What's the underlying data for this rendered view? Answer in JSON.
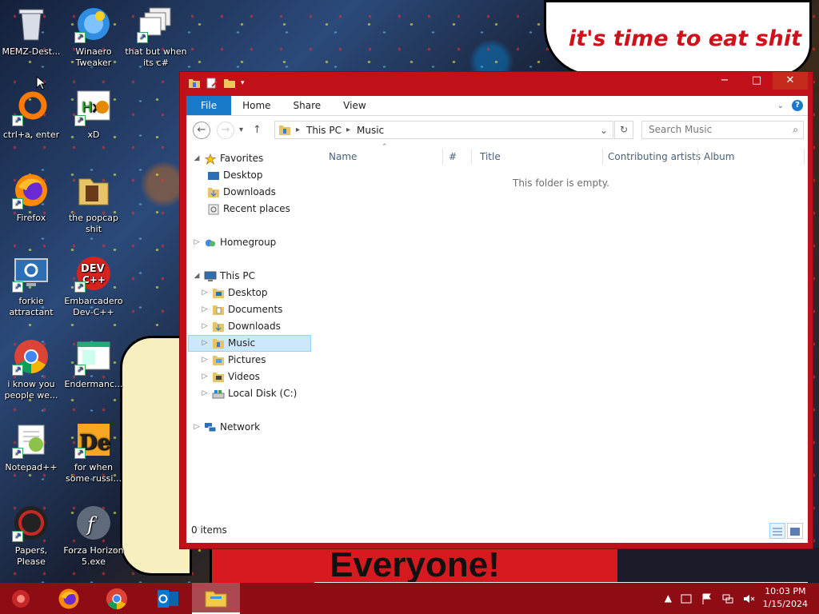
{
  "desktop": {
    "icons": [
      {
        "label": "MEMZ-Dest...",
        "icon": "recycle-bin-icon"
      },
      {
        "label": "Winaero Tweaker",
        "icon": "winaero-icon"
      },
      {
        "label": "that but when its c#",
        "icon": "windows-stack-icon"
      },
      {
        "label": "ctrl+a, enter",
        "icon": "ring-icon"
      },
      {
        "label": "xD",
        "icon": "hxd-icon"
      },
      {
        "label": "Firefox",
        "icon": "firefox-icon"
      },
      {
        "label": "the popcap shit",
        "icon": "folder-icon"
      },
      {
        "label": "forkie attractant",
        "icon": "monitor-gear-icon"
      },
      {
        "label": "Embarcadero Dev-C++",
        "icon": "devcpp-icon"
      },
      {
        "label": "i know you people we...",
        "icon": "chrome-icon"
      },
      {
        "label": "Endermanc...",
        "icon": "app-window-icon"
      },
      {
        "label": "Notepad++",
        "icon": "notepadpp-icon"
      },
      {
        "label": "for when some russi...",
        "icon": "de-icon"
      },
      {
        "label": "Papers, Please",
        "icon": "papers-please-icon"
      },
      {
        "label": "Forza Horizon 5.exe",
        "icon": "flash-icon"
      }
    ],
    "bubble_text": "it's time to eat shit",
    "banner_text": "Everyone!"
  },
  "window": {
    "ribbon_tabs": [
      "File",
      "Home",
      "Share",
      "View"
    ],
    "address": {
      "segments": [
        "This PC",
        "Music"
      ]
    },
    "search_placeholder": "Search Music",
    "nav": {
      "favorites": "Favorites",
      "favorites_items": [
        "Desktop",
        "Downloads",
        "Recent places"
      ],
      "homegroup": "Homegroup",
      "thispc": "This PC",
      "thispc_items": [
        "Desktop",
        "Documents",
        "Downloads",
        "Music",
        "Pictures",
        "Videos",
        "Local Disk (C:)"
      ],
      "network": "Network",
      "selected": "Music"
    },
    "columns": [
      "Name",
      "#",
      "Title",
      "Contributing artists",
      "Album"
    ],
    "empty_text": "This folder is empty.",
    "status_text": "0 items"
  },
  "taskbar": {
    "items": [
      "start-icon",
      "firefox-icon",
      "chrome-icon",
      "outlook-icon",
      "file-explorer-icon"
    ],
    "active": "file-explorer-icon",
    "time": "10:03 PM",
    "date": "1/15/2024"
  },
  "colors": {
    "window_frame": "#c0101a",
    "file_tab": "#1979ca",
    "taskbar": "#8e0c14",
    "selection": "#cce8ff"
  }
}
